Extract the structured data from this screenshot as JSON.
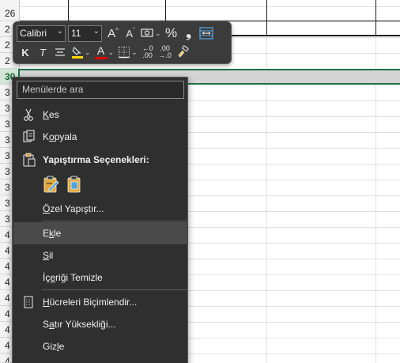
{
  "sheet": {
    "row_numbers": [
      "26",
      "2",
      "2",
      "2",
      "30",
      "3",
      "3",
      "3",
      "3",
      "3",
      "3",
      "3",
      "3",
      "3",
      "4",
      "4",
      "4",
      "4",
      "4",
      "4",
      "4",
      "4",
      "4"
    ],
    "selected_row": "30"
  },
  "mini_toolbar": {
    "font_name": "Calibri",
    "font_size": "11",
    "grow_font_glyph": "A",
    "shrink_font_glyph": "A",
    "percent_glyph": "%",
    "comma_glyph": "❟",
    "bold_glyph": "K",
    "italic_glyph": "T",
    "font_color_glyph": "A",
    "inc_decimal_top": "←0",
    "inc_decimal_bottom": ".00",
    "dec_decimal_top": ".00",
    "dec_decimal_bottom": "→.0",
    "fill_color": "#ffd700",
    "font_color": "#e00000",
    "icons": [
      "font-name-combo",
      "font-size-combo",
      "grow-font-icon",
      "shrink-font-icon",
      "accounting-format-icon",
      "percent-icon",
      "comma-style-icon",
      "merge-center-icon",
      "bold-icon",
      "italic-icon",
      "align-center-icon",
      "fill-color-icon",
      "font-color-icon",
      "borders-icon",
      "increase-decimal-icon",
      "decrease-decimal-icon",
      "format-painter-icon"
    ]
  },
  "context_menu": {
    "search_placeholder": "Menülerde ara",
    "items": [
      {
        "pre": "",
        "u": "K",
        "post": "es",
        "icon": "scissors-icon"
      },
      {
        "pre": "K",
        "u": "o",
        "post": "pyala",
        "icon": "copy-icon"
      },
      {
        "pre": "Yapıştırma Seçenekleri:",
        "u": "",
        "post": "",
        "icon": "clipboard-icon"
      },
      {
        "pre": "",
        "u": "Ö",
        "post": "zel Yapıştır...",
        "icon": ""
      },
      {
        "pre": "E",
        "u": "k",
        "post": "le",
        "icon": ""
      },
      {
        "pre": "",
        "u": "S",
        "post": "il",
        "icon": ""
      },
      {
        "pre": "İç",
        "u": "e",
        "post": "riği Temizle",
        "icon": ""
      },
      {
        "pre": "",
        "u": "H",
        "post": "ücreleri Biçimlendir...",
        "icon": "format-cells-icon"
      },
      {
        "pre": "S",
        "u": "a",
        "post": "tır Yüksekliği...",
        "icon": ""
      },
      {
        "pre": "Giz",
        "u": "l",
        "post": "e",
        "icon": ""
      }
    ],
    "paste_options": [
      "paste-formulas-icon",
      "paste-icon"
    ],
    "hovered_item": "Ekle"
  }
}
